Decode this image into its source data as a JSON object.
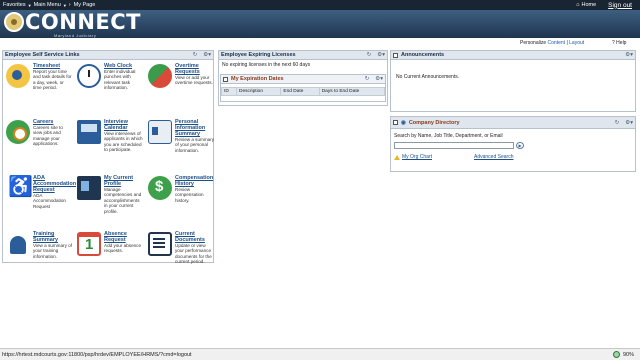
{
  "topnav": {
    "favorites": "Favorites",
    "main_menu": "Main Menu",
    "breadcrumb": "My Page",
    "home": "Home",
    "signout": "Sign out"
  },
  "banner": {
    "logo_text": "CONNECT",
    "logo_sub": "Maryland Judiciary"
  },
  "personalize": {
    "prefix": "Personalize",
    "content": "Content",
    "sep": "|",
    "layout": "Layout",
    "help": "Help"
  },
  "ess": {
    "title": "Employee Self Service Links",
    "items": [
      {
        "title": "Timesheet",
        "desc": "Report your time and task details for a day, week, or time period.",
        "icon": "timesheet-icon"
      },
      {
        "title": "Web Clock",
        "desc": "Enter individual punches with relevant task information.",
        "icon": "clock-icon"
      },
      {
        "title": "Overtime Requests",
        "desc": "View or add your overtime requests.",
        "icon": "overtime-icon"
      },
      {
        "title": "Careers",
        "desc": "Careers site to view jobs and manage your applications.",
        "icon": "careers-icon"
      },
      {
        "title": "Interview Calendar",
        "desc": "View interviews of applicants in which you are scheduled to participate.",
        "icon": "interview-icon"
      },
      {
        "title": "Personal Information Summary",
        "desc": "Review a summary of your personal information.",
        "icon": "personal-info-icon"
      },
      {
        "title": "ADA Accommodation Request",
        "desc": "ADA Accommodation Request",
        "icon": "wheelchair-icon"
      },
      {
        "title": "My Current Profile",
        "desc": "Manage competencies and accomplishments in your current profile.",
        "icon": "profile-icon"
      },
      {
        "title": "Compensation History",
        "desc": "Review compensation history.",
        "icon": "dollar-icon"
      },
      {
        "title": "Training Summary",
        "desc": "View a summary of your training information.",
        "icon": "graduation-icon"
      },
      {
        "title": "Absence Request",
        "desc": "Add your absence requests.",
        "icon": "calendar-icon"
      },
      {
        "title": "Current Documents",
        "desc": "Update or view your performance documents for the current period.",
        "icon": "document-icon"
      }
    ]
  },
  "licenses": {
    "title": "Employee Expiring Licenses",
    "empty_text": "No expiring licenses in the next 60 days",
    "sub_title": "My Expiration Dates",
    "columns": [
      "ID",
      "Description",
      "End Date",
      "Days to End Date"
    ]
  },
  "announcements": {
    "title": "Announcements",
    "empty_text": "No Current Announcements."
  },
  "directory": {
    "title": "Company Directory",
    "search_label": "Search by Name, Job Title, Department, or Email",
    "search_value": "",
    "org_chart": "My Org Chart",
    "advanced": "Advanced Search"
  },
  "statusbar": {
    "url": "https://hrtest.mdcourts.gov:11800/psp/hrdev/EMPLOYEE/HRMS/?cmd=logout",
    "zoom": "90%"
  }
}
